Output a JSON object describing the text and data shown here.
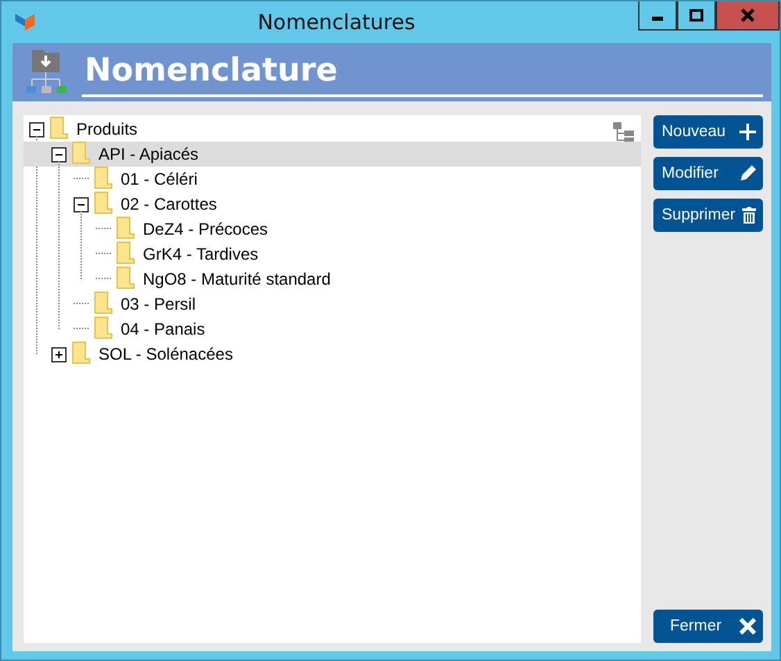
{
  "window": {
    "title": "Nomenclatures"
  },
  "header": {
    "title": "Nomenclature"
  },
  "tree": [
    {
      "label": "Produits",
      "expanded": true,
      "selected": false,
      "children": [
        {
          "label": "API - Apiacés",
          "expanded": true,
          "selected": true,
          "children": [
            {
              "label": "01 - Céléri",
              "selected": false
            },
            {
              "label": "02 - Carottes",
              "expanded": true,
              "selected": false,
              "children": [
                {
                  "label": "DeZ4 - Précoces",
                  "selected": false
                },
                {
                  "label": "GrK4 - Tardives",
                  "selected": false
                },
                {
                  "label": "NgO8 - Maturité standard",
                  "selected": false
                }
              ]
            },
            {
              "label": "03 - Persil",
              "selected": false
            },
            {
              "label": "04 - Panais",
              "selected": false
            }
          ]
        },
        {
          "label": "SOL - Solénacées",
          "expanded": false,
          "selected": false
        }
      ]
    }
  ],
  "buttons": [
    {
      "label": "Nouveau",
      "kind": "add"
    },
    {
      "label": "Modifier",
      "kind": "edit"
    },
    {
      "label": "Supprimer",
      "kind": "delete"
    }
  ],
  "close_button": {
    "label": "Fermer"
  }
}
